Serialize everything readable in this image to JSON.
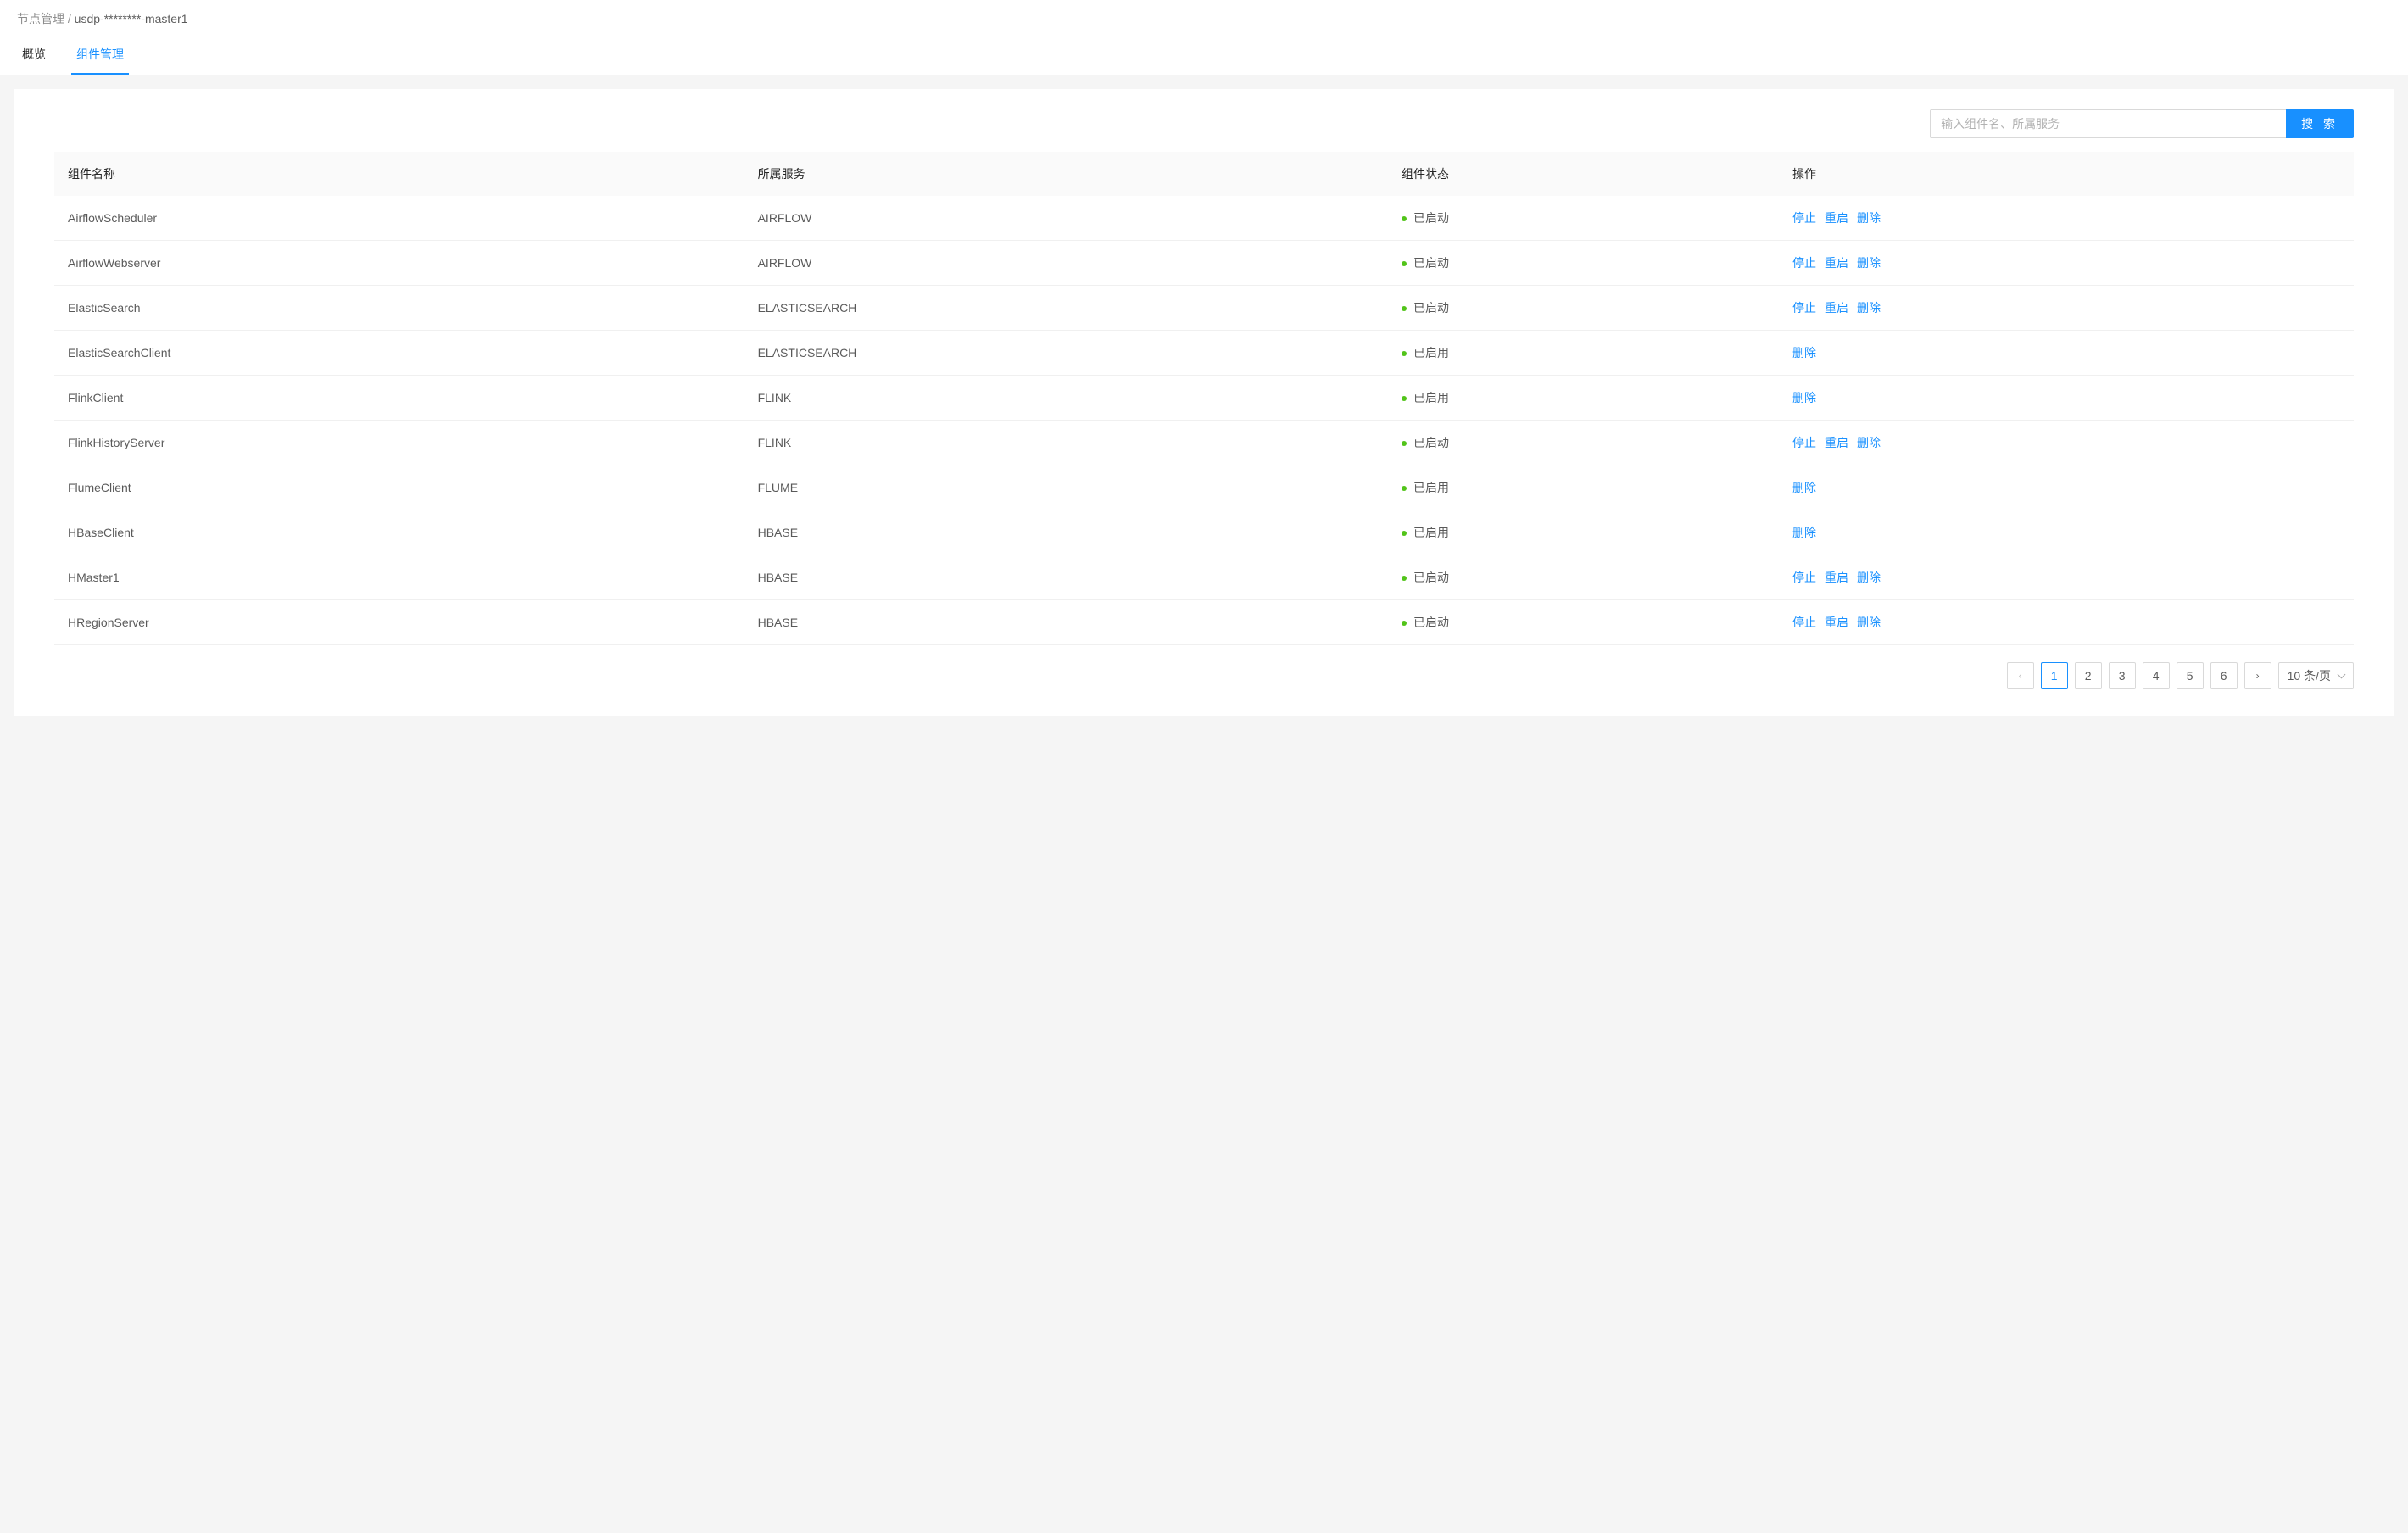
{
  "breadcrumb": {
    "root": "节点管理",
    "separator": "/",
    "current": "usdp-********-master1"
  },
  "tabs": {
    "overview": "概览",
    "component_mgmt": "组件管理"
  },
  "search": {
    "placeholder": "输入组件名、所属服务",
    "button": "搜 索"
  },
  "table": {
    "headers": {
      "name": "组件名称",
      "service": "所属服务",
      "status": "组件状态",
      "action": "操作"
    },
    "actions": {
      "stop": "停止",
      "restart": "重启",
      "delete": "删除"
    },
    "status_labels": {
      "started": "已启动",
      "enabled": "已启用"
    },
    "rows": [
      {
        "name": "AirflowScheduler",
        "service": "AIRFLOW",
        "status": "started",
        "actions": [
          "stop",
          "restart",
          "delete"
        ]
      },
      {
        "name": "AirflowWebserver",
        "service": "AIRFLOW",
        "status": "started",
        "actions": [
          "stop",
          "restart",
          "delete"
        ]
      },
      {
        "name": "ElasticSearch",
        "service": "ELASTICSEARCH",
        "status": "started",
        "actions": [
          "stop",
          "restart",
          "delete"
        ]
      },
      {
        "name": "ElasticSearchClient",
        "service": "ELASTICSEARCH",
        "status": "enabled",
        "actions": [
          "delete"
        ]
      },
      {
        "name": "FlinkClient",
        "service": "FLINK",
        "status": "enabled",
        "actions": [
          "delete"
        ]
      },
      {
        "name": "FlinkHistoryServer",
        "service": "FLINK",
        "status": "started",
        "actions": [
          "stop",
          "restart",
          "delete"
        ]
      },
      {
        "name": "FlumeClient",
        "service": "FLUME",
        "status": "enabled",
        "actions": [
          "delete"
        ]
      },
      {
        "name": "HBaseClient",
        "service": "HBASE",
        "status": "enabled",
        "actions": [
          "delete"
        ]
      },
      {
        "name": "HMaster1",
        "service": "HBASE",
        "status": "started",
        "actions": [
          "stop",
          "restart",
          "delete"
        ]
      },
      {
        "name": "HRegionServer",
        "service": "HBASE",
        "status": "started",
        "actions": [
          "stop",
          "restart",
          "delete"
        ]
      }
    ]
  },
  "pagination": {
    "pages": [
      "1",
      "2",
      "3",
      "4",
      "5",
      "6"
    ],
    "current": "1",
    "page_size_label": "10 条/页"
  }
}
